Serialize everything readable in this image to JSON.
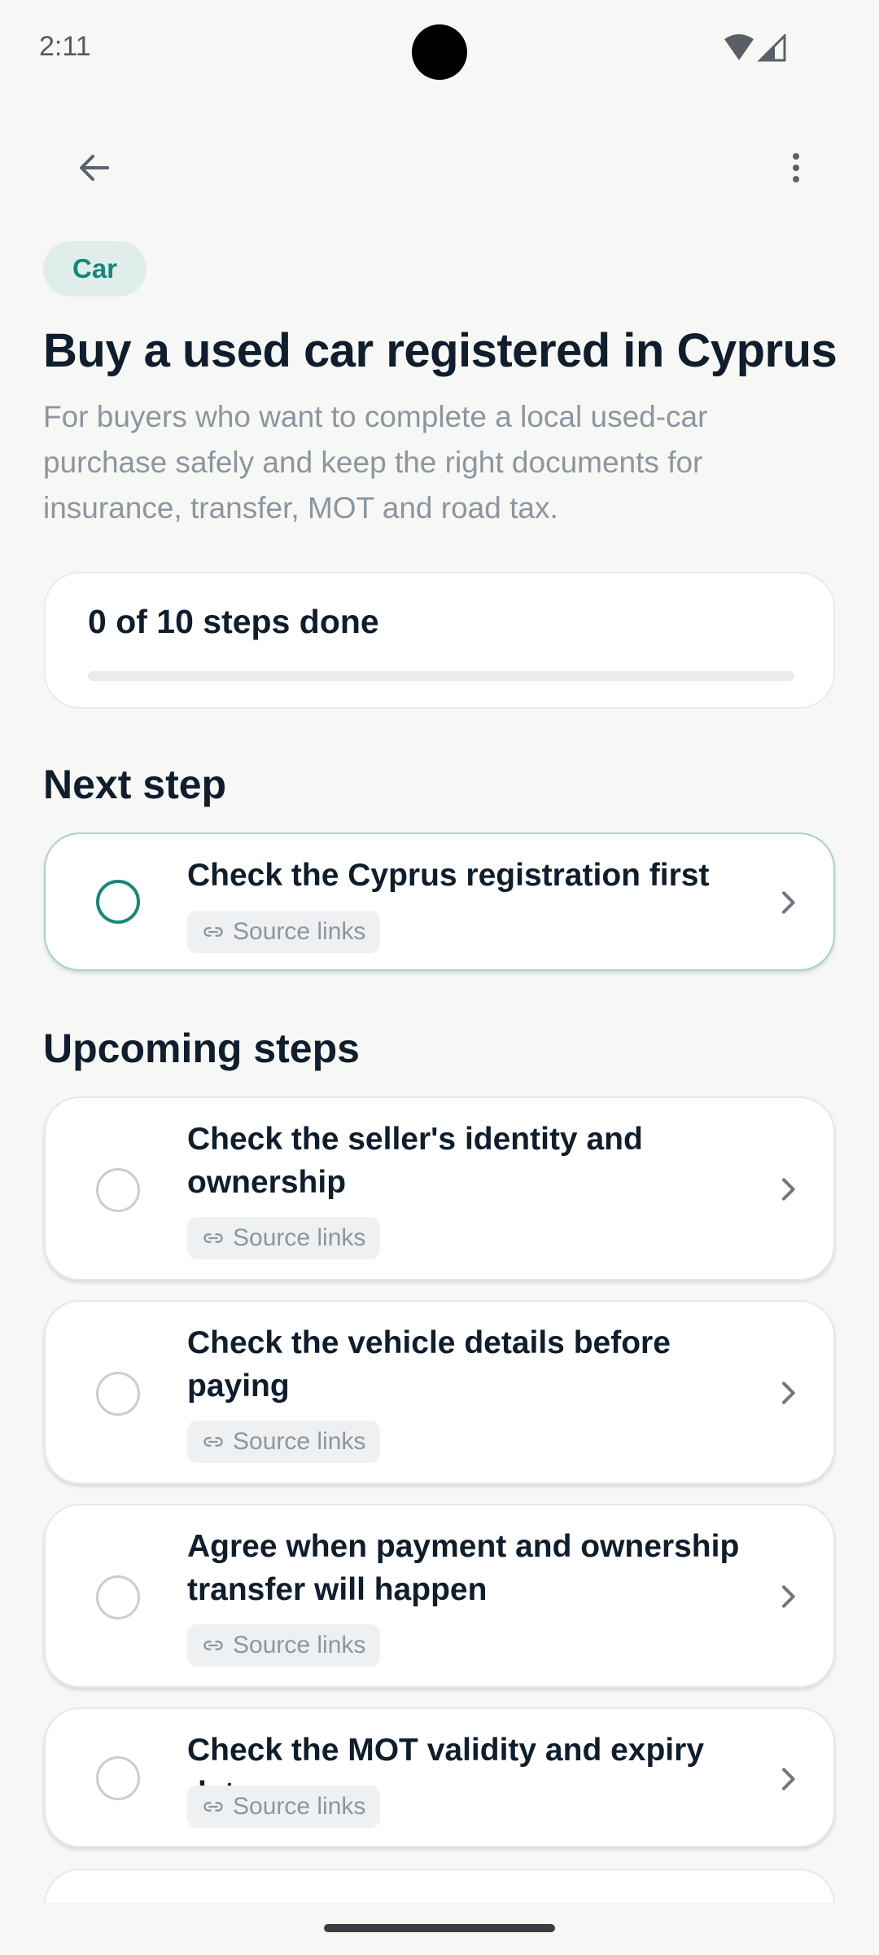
{
  "status_bar": {
    "time": "2:11"
  },
  "header": {
    "category": "Car",
    "title": "Buy a used car registered in Cyprus",
    "description": "For buyers who want to complete a local used-car purchase safely and keep the right documents for insurance, transfer, MOT and road tax."
  },
  "progress": {
    "label": "0 of 10 steps done",
    "done": 0,
    "total": 10
  },
  "sections": {
    "next": "Next step",
    "upcoming": "Upcoming steps"
  },
  "next_step": {
    "title": "Check the Cyprus registration first",
    "source": "Source links"
  },
  "upcoming_steps": [
    {
      "title": "Check the seller's identity and ownership",
      "source": "Source links"
    },
    {
      "title": "Check the vehicle details before paying",
      "source": "Source links"
    },
    {
      "title": "Agree when payment and ownership transfer will happen",
      "source": "Source links"
    },
    {
      "title": "Check the MOT validity and expiry date",
      "source": "Source links"
    }
  ],
  "colors": {
    "accent": "#17877a",
    "chip_bg": "#e0eeeb",
    "background": "#f7f7f5"
  }
}
